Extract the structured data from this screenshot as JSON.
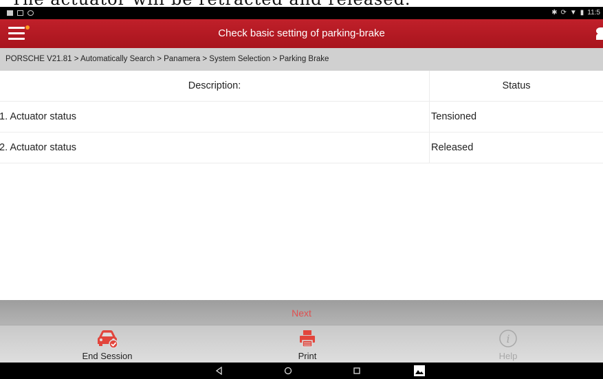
{
  "caption": "The actuator will be retracted and released.",
  "status_bar": {
    "time": "11:5"
  },
  "header": {
    "title": "Check basic setting of parking-brake"
  },
  "breadcrumb": "PORSCHE V21.81 > Automatically Search > Panamera > System Selection > Parking Brake",
  "table": {
    "columns": [
      "Description:",
      "Status"
    ],
    "rows": [
      {
        "description": "1. Actuator status",
        "status": "Tensioned"
      },
      {
        "description": "2. Actuator status",
        "status": "Released"
      }
    ]
  },
  "next_label": "Next",
  "toolbar": {
    "end_session_label": "End Session",
    "print_label": "Print",
    "help_label": "Help"
  },
  "colors": {
    "accent": "#b3161f",
    "icon_red": "#e2453c",
    "next_text": "#e05050"
  },
  "icons": [
    "menu-icon",
    "notification-dot-icon",
    "user-icon",
    "car-check-icon",
    "printer-icon",
    "info-icon",
    "back-icon",
    "home-icon",
    "recents-icon",
    "screenshot-icon"
  ]
}
